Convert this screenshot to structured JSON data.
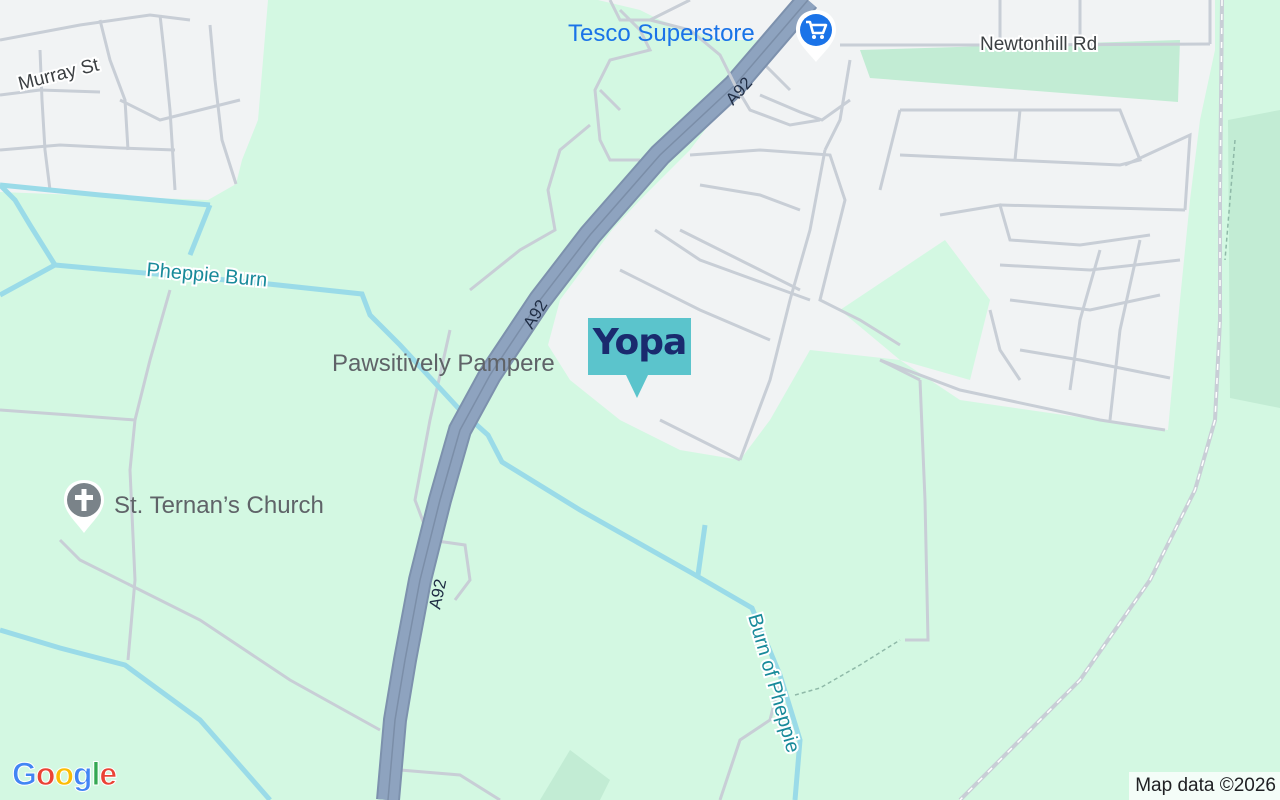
{
  "map": {
    "places": {
      "tesco": "Tesco Superstore",
      "pawsitively": "Pawsitively Pampere",
      "church": "St. Ternan’s Church"
    },
    "streets": {
      "murray": "Murray St",
      "newtonhill": "Newtonhill Rd"
    },
    "roads": {
      "a92": "A92"
    },
    "water": {
      "pheppie_burn": "Pheppie Burn",
      "burn_of_pheppie": "Burn of Pheppie"
    },
    "marker": {
      "brand": "Yopa"
    },
    "attribution": "Map data ©2026",
    "google_logo": [
      "G",
      "o",
      "o",
      "g",
      "l",
      "e"
    ]
  },
  "icons": {
    "shop_pin": "shopping-cart-icon",
    "church_pin": "cross-icon"
  },
  "colors": {
    "land": "#d3f8e2",
    "urban": "#f1f3f4",
    "road_outline": "#c8ced6",
    "motorway": "#8ea3bf",
    "water": "#9adbe8",
    "water_label": "#188a9a",
    "shop_pin": "#1a73e8",
    "church_pin": "#7a8389",
    "yopa_marker": "#5bc4cc",
    "yopa_text": "#1a2a6e",
    "google": [
      "#4285f4",
      "#ea4335",
      "#fbbc05",
      "#4285f4",
      "#34a853",
      "#ea4335"
    ]
  }
}
